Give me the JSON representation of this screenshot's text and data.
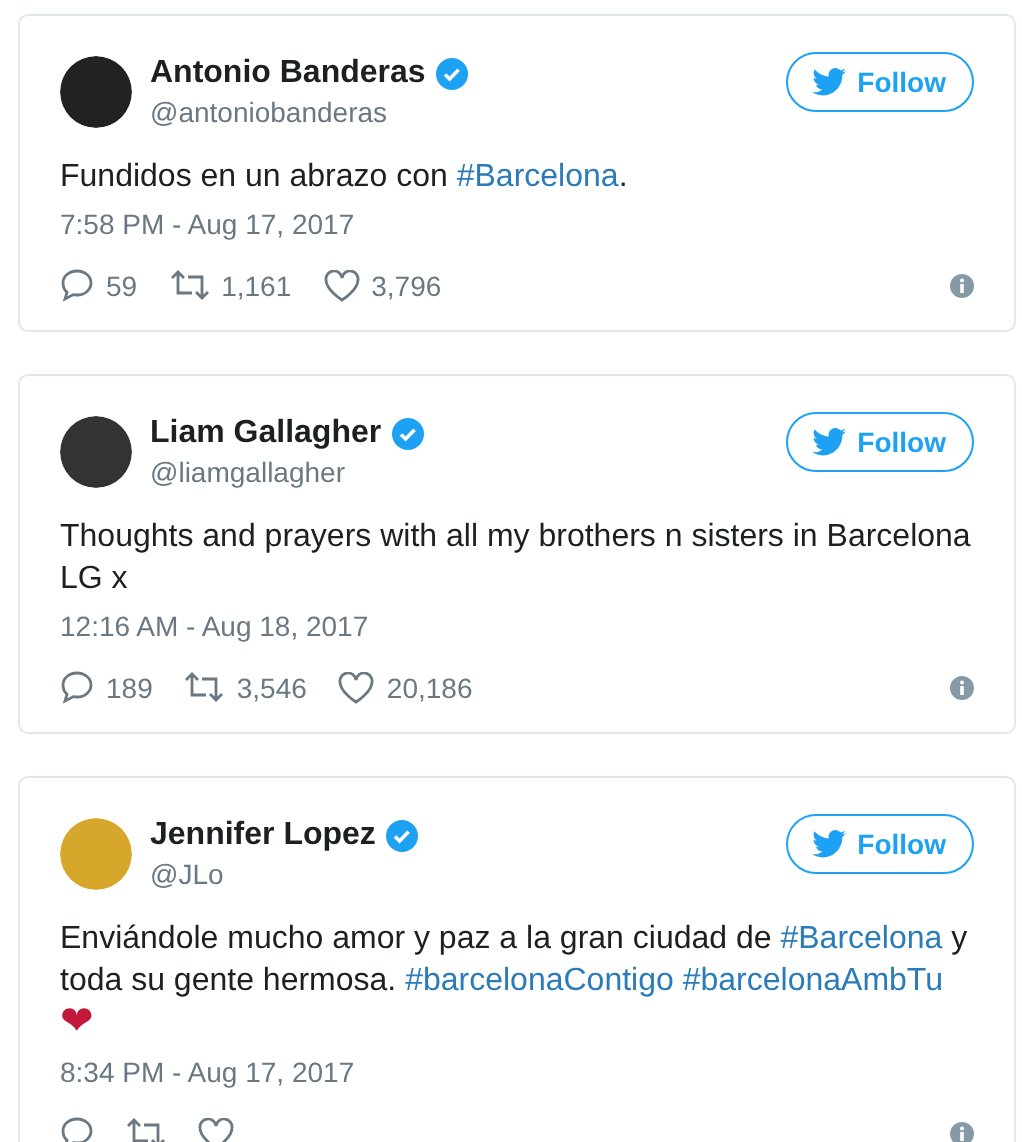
{
  "tweets": [
    {
      "name": "Antonio Banderas",
      "handle": "@antoniobanderas",
      "verified": true,
      "follow": "Follow",
      "body": [
        {
          "kind": "text",
          "text": "Fundidos en un abrazo con "
        },
        {
          "kind": "hashtag",
          "text": "#Barcelona"
        },
        {
          "kind": "text",
          "text": "."
        }
      ],
      "time": "7:58 PM - Aug 17, 2017",
      "stats": {
        "replies": "59",
        "retweets": "1,161",
        "likes": "3,796"
      }
    },
    {
      "name": "Liam Gallagher",
      "handle": "@liamgallagher",
      "verified": true,
      "follow": "Follow",
      "body": [
        {
          "kind": "text",
          "text": "Thoughts and prayers with all my brothers n sisters in Barcelona\nLG x"
        }
      ],
      "time": "12:16 AM - Aug 18, 2017",
      "stats": {
        "replies": "189",
        "retweets": "3,546",
        "likes": "20,186"
      }
    },
    {
      "name": "Jennifer Lopez",
      "handle": "@JLo",
      "verified": true,
      "follow": "Follow",
      "body": [
        {
          "kind": "text",
          "text": "Enviándole mucho amor y paz a la gran ciudad de "
        },
        {
          "kind": "hashtag",
          "text": "#Barcelona"
        },
        {
          "kind": "text",
          "text": " y toda su gente hermosa. "
        },
        {
          "kind": "hashtag",
          "text": "#barcelonaContigo"
        },
        {
          "kind": "hashtag",
          "text": "#barcelonaAmbTu",
          "space_before": true
        },
        {
          "kind": "emoji",
          "text": "❤"
        }
      ],
      "time": "8:34 PM - Aug 17, 2017"
    }
  ]
}
